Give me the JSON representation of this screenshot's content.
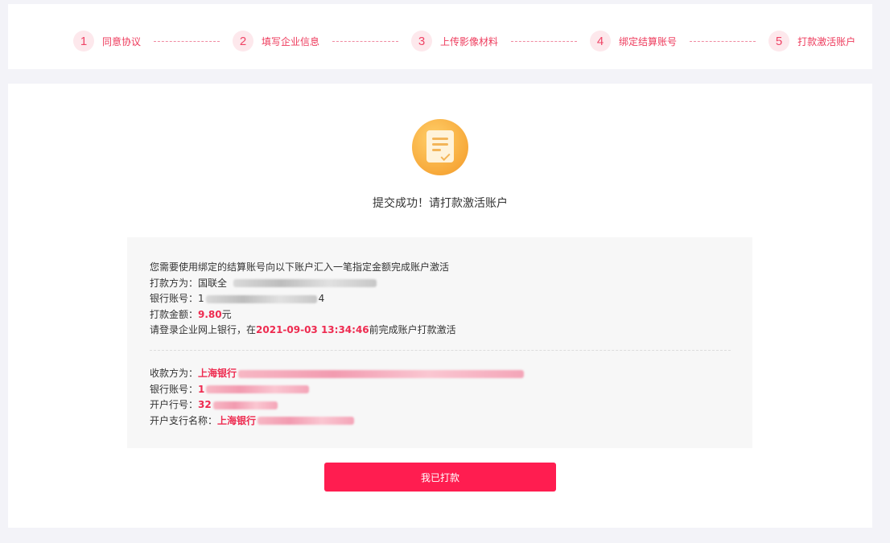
{
  "steps": [
    {
      "num": "1",
      "label": "同意协议"
    },
    {
      "num": "2",
      "label": "填写企业信息"
    },
    {
      "num": "3",
      "label": "上传影像材料"
    },
    {
      "num": "4",
      "label": "绑定结算账号"
    },
    {
      "num": "5",
      "label": "打款激活账户"
    }
  ],
  "success": {
    "title": "提交成功！请打款激活账户"
  },
  "instructions": {
    "intro": "您需要使用绑定的结算账号向以下账户汇入一笔指定金额完成账户激活",
    "payer_label": "打款方为：",
    "payer_value": "国联全",
    "bank_account_label": "银行账号：",
    "bank_account_start": "1",
    "bank_account_end": "4",
    "amount_label": "打款金额：",
    "amount_value": "9.80",
    "amount_unit": "元",
    "deadline_prefix": "请登录企业网上银行，在",
    "deadline_value": "2021-09-03 13:34:46",
    "deadline_suffix": "前完成账户打款激活"
  },
  "payee": {
    "payee_label": "收款方为：",
    "payee_value": "上海银行",
    "bank_account_label": "银行账号：",
    "bank_account_value": "1",
    "bank_code_label": "开户行号：",
    "bank_code_value": "32",
    "branch_label": "开户支行名称：",
    "branch_value": "上海银行"
  },
  "actions": {
    "paid_label": "我已打款"
  },
  "colors": {
    "accent": "#ff1d50",
    "highlight": "#ee2b50",
    "icon": "#f7a93a"
  }
}
